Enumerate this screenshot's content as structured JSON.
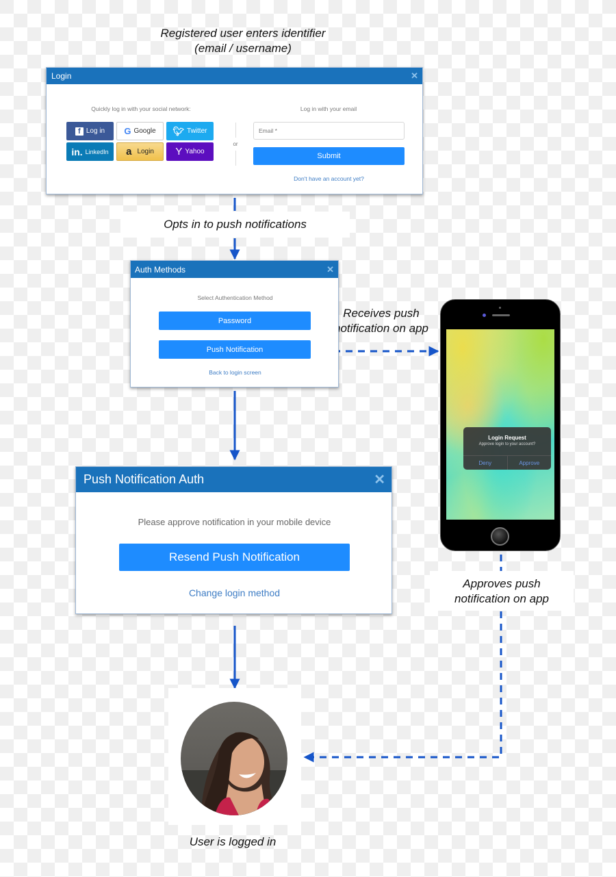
{
  "captions": {
    "step1_line1": "Registered user enters identifier",
    "step1_line2": "(email / username)",
    "step2": "Opts in to push notifications",
    "step3_line1": "Receives push",
    "step3_line2": "notification on app",
    "step4_line1": "Approves push",
    "step4_line2": "notification on app",
    "step5": "User is logged in"
  },
  "login_dialog": {
    "title": "Login",
    "close_icon": "close-icon",
    "social_heading": "Quickly log in with your social network:",
    "social_buttons": [
      {
        "provider": "facebook",
        "icon": "f",
        "label": "Log in",
        "color": "#3b5998"
      },
      {
        "provider": "google",
        "icon": "G",
        "label": "Google",
        "color": "#ffffff"
      },
      {
        "provider": "twitter",
        "icon": "❧",
        "label": "Twitter",
        "color": "#1daaf0"
      },
      {
        "provider": "linkedin",
        "icon": "in.",
        "label": "LinkedIn",
        "color": "#0a7bb6"
      },
      {
        "provider": "amazon",
        "icon": "a",
        "label": "Login",
        "color": "#f4c96a"
      },
      {
        "provider": "yahoo",
        "icon": "Y",
        "label": "Yahoo",
        "color": "#5c0ebf"
      }
    ],
    "divider_label": "or",
    "email_heading": "Log in with your email",
    "email_placeholder": "Email *",
    "email_value": "",
    "submit_label": "Submit",
    "signup_link": "Don't have an account yet?"
  },
  "auth_dialog": {
    "title": "Auth Methods",
    "heading": "Select Authentication Method",
    "password_label": "Password",
    "push_label": "Push Notification",
    "back_link": "Back to login screen"
  },
  "push_dialog": {
    "title": "Push Notification Auth",
    "message": "Please approve notification in your mobile device",
    "resend_label": "Resend Push Notification",
    "change_link": "Change login method"
  },
  "phone": {
    "alert_title": "Login Request",
    "alert_message": "Approve login to your account?",
    "deny_label": "Deny",
    "approve_label": "Approve"
  },
  "colors": {
    "arrow": "#1655c9",
    "header": "#1a72bb",
    "primary_button": "#1e8cff"
  }
}
